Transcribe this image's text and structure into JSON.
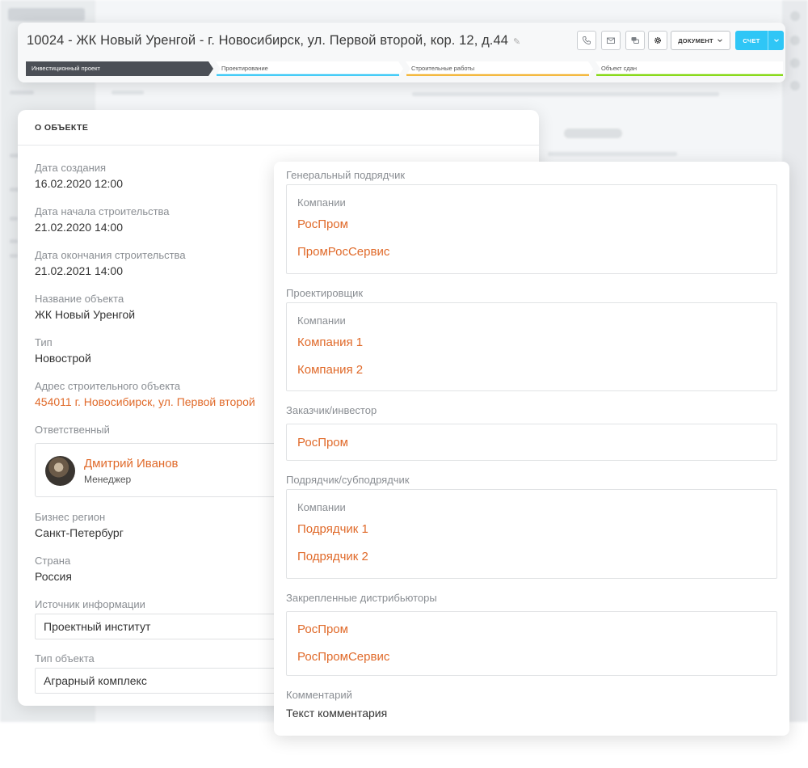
{
  "header": {
    "title": "10024 - ЖК Новый Уренгой - г. Новосибирск, ул. Первой второй, кор. 12, д.44",
    "document_label": "ДОКУМЕНТ",
    "invoice_label": "СЧЕТ",
    "stages": [
      {
        "label": "Инвестиционный проект",
        "color": "#4b4f56"
      },
      {
        "label": "Проектирование",
        "color": "#2fc6f6"
      },
      {
        "label": "Строительные работы",
        "color": "#f2b12a"
      },
      {
        "label": "Объект сдан",
        "color": "#7bd500"
      }
    ]
  },
  "about": {
    "heading": "О ОБЪЕКТЕ",
    "created_label": "Дата создания",
    "created_value": "16.02.2020 12:00",
    "start_label": "Дата начала строительства",
    "start_value": "21.02.2020 14:00",
    "end_label": "Дата окончания строительства",
    "end_value": "21.02.2021 14:00",
    "name_label": "Название объекта",
    "name_value": "ЖК Новый Уренгой",
    "type_label": "Тип",
    "type_value": "Новострой",
    "address_label": "Адрес строительного объекта",
    "address_value": "454011 г. Новосибирск, ул. Первой второй",
    "responsible_label": "Ответственный",
    "responsible_name": "Дмитрий Иванов",
    "responsible_role": "Менеджер",
    "region_label": "Бизнес регион",
    "region_value": "Санкт-Петербург",
    "country_label": "Страна",
    "country_value": "Россия",
    "source_label": "Источник информации",
    "source_value": "Проектный институт",
    "objtype_label": "Тип объекта",
    "objtype_value": "Аграрный комплекс"
  },
  "parties": {
    "general_label": "Генеральный подрядчик",
    "general_sub": "Компании",
    "general_items": [
      "РосПром",
      "ПромРосСервис"
    ],
    "designer_label": "Проектировщик",
    "designer_sub": "Компании",
    "designer_items": [
      "Компания 1",
      "Компания 2"
    ],
    "customer_label": "Заказчик/инвестор",
    "customer_items": [
      "РосПром"
    ],
    "contractor_label": "Подрядчик/субподрядчик",
    "contractor_sub": "Компании",
    "contractor_items": [
      "Подрядчик 1",
      "Подрядчик 2"
    ],
    "distributors_label": "Закрепленные дистрибьюторы",
    "distributors_items": [
      "РосПром",
      "РосПромСервис"
    ],
    "comment_label": "Комментарий",
    "comment_value": "Текст комментария"
  },
  "colors": {
    "accent": "#e06a2a",
    "primary_button": "#2fc6f6"
  }
}
